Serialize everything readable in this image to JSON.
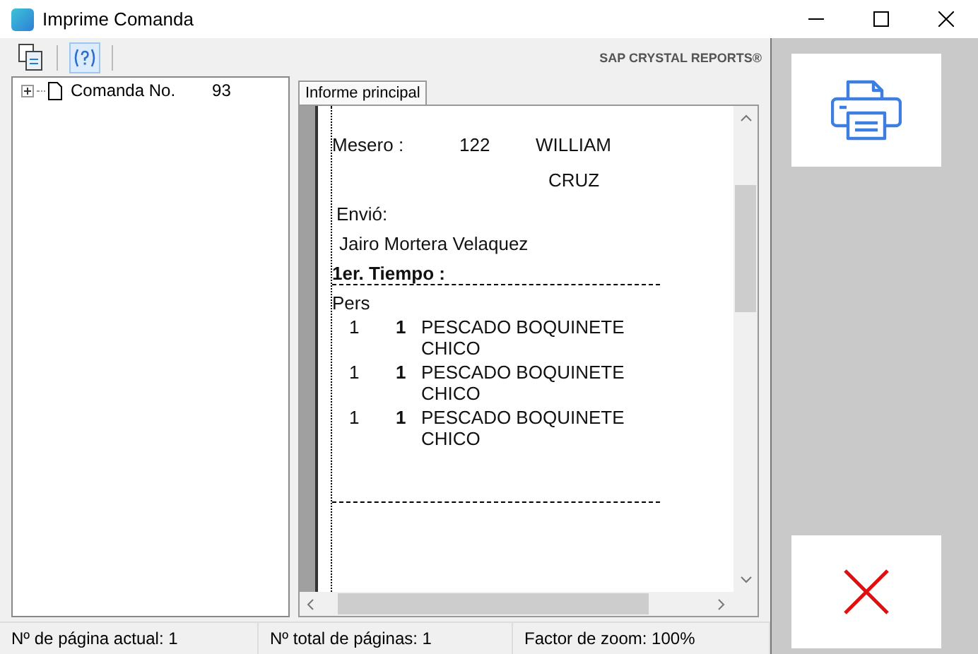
{
  "window": {
    "title": "Imprime Comanda"
  },
  "toolbar": {
    "brand": "SAP CRYSTAL REPORTS®"
  },
  "tree": {
    "items": [
      {
        "label": "Comanda No.",
        "value": "93",
        "expanded": false
      }
    ]
  },
  "tabs": [
    {
      "label": "Informe principal",
      "selected": true
    }
  ],
  "report": {
    "waiter_label": "Mesero :",
    "waiter_id": "122",
    "waiter_name_1": "WILLIAM",
    "waiter_name_2": "CRUZ",
    "sent_label": "Envió:",
    "sent_by": "Jairo Mortera Velaquez",
    "course": "1er. Tiempo :",
    "pers_label": "Pers",
    "items": [
      {
        "pers": "1",
        "qty": "1",
        "description": "PESCADO BOQUINETE CHICO"
      },
      {
        "pers": "1",
        "qty": "1",
        "description": "PESCADO BOQUINETE CHICO"
      },
      {
        "pers": "1",
        "qty": "1",
        "description": "PESCADO BOQUINETE CHICO"
      }
    ]
  },
  "status_bar": [
    "Nº de página actual: 1",
    "Nº total de páginas: 1",
    "Factor de zoom: 100%"
  ]
}
